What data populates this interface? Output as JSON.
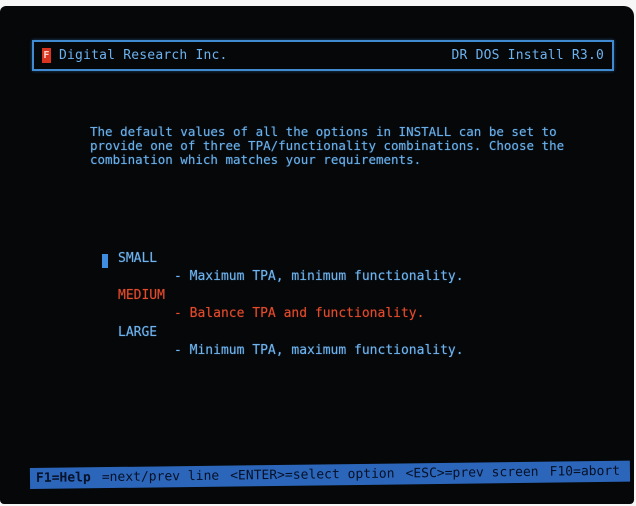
{
  "titlebar": {
    "logo": "F",
    "company": "Digital Research Inc.",
    "product": "DR DOS Install R3.0"
  },
  "description": "The default values of all the options in INSTALL can be set to\nprovide one of three TPA/functionality combinations. Choose the\ncombination which matches your requirements.",
  "options": [
    {
      "name": "SMALL",
      "desc": "- Maximum TPA, minimum functionality.",
      "selected": false
    },
    {
      "name": "MEDIUM",
      "desc": "- Balance TPA and functionality.",
      "selected": true
    },
    {
      "name": "LARGE",
      "desc": "- Minimum TPA, maximum functionality.",
      "selected": false
    }
  ],
  "statusbar": {
    "help": "F1=Help",
    "next_prev": "=next/prev line",
    "enter": "<ENTER>=select option",
    "esc": "<ESC>=prev screen",
    "abort": "F10=abort"
  },
  "colors": {
    "screen_bg": "#050709",
    "text_blue": "#69b0ea",
    "selected_red": "#e44a2c",
    "statusbar_bg": "#2c66ba",
    "logo_red": "#d93420"
  }
}
